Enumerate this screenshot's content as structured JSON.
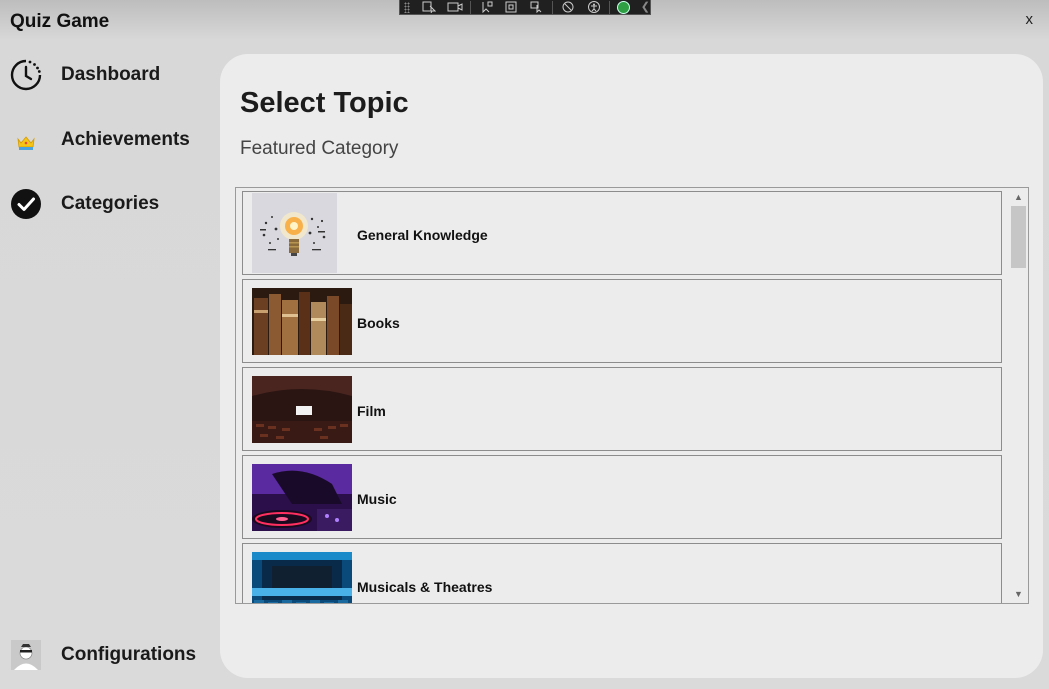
{
  "app": {
    "title": "Quiz Game",
    "close_label": "x"
  },
  "devtools": {
    "icons": [
      "select-element-icon",
      "video-icon",
      "pointer-icon",
      "layout-icon",
      "cursor-select-icon",
      "hot-reload-icon",
      "accessibility-icon",
      "check-icon",
      "collapse-icon"
    ]
  },
  "sidebar": {
    "items": [
      {
        "label": "Dashboard",
        "icon": "clock-icon"
      },
      {
        "label": "Achievements",
        "icon": "crown-icon"
      },
      {
        "label": "Categories",
        "icon": "checkmark-icon"
      }
    ],
    "bottom_item": {
      "label": "Configurations",
      "icon": "avatar-icon"
    }
  },
  "main": {
    "title": "Select Topic",
    "subtitle": "Featured Category",
    "categories": [
      {
        "label": "General Knowledge",
        "image": "lightbulb"
      },
      {
        "label": "Books",
        "image": "books"
      },
      {
        "label": "Film",
        "image": "cinema"
      },
      {
        "label": "Music",
        "image": "dj-turntable"
      },
      {
        "label": "Musicals & Theatres",
        "image": "theatre-stage"
      }
    ]
  },
  "colors": {
    "panel": "#ececec",
    "sidebar_bg": "#dadada",
    "accent_dark": "#111111"
  }
}
